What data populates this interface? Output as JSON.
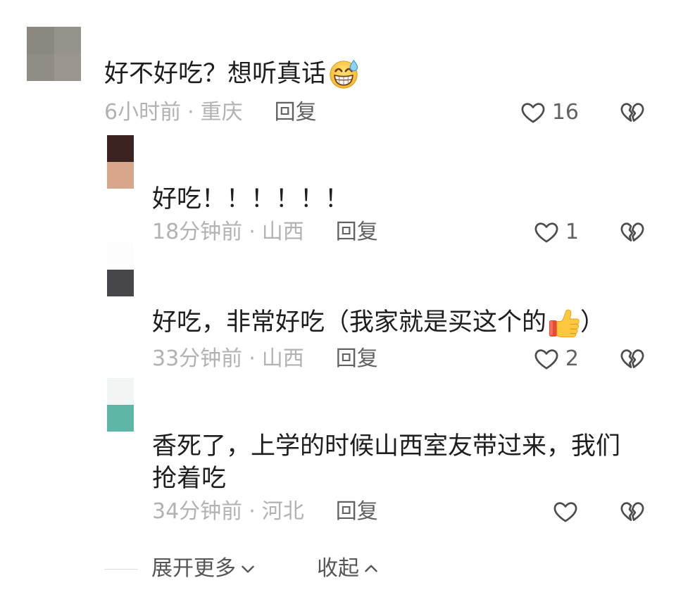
{
  "colors": {
    "text": "#1e1e1e",
    "meta": "#b2b2b2",
    "action": "#626262",
    "icon": "#4c4c4c",
    "divider": "#dddddd",
    "footer": "#555555"
  },
  "separator": "·",
  "icons": {
    "like": "heart-outline",
    "dislike": "broken-heart",
    "expand": "chevron-down",
    "collapse": "chevron-up"
  },
  "comment": {
    "avatar_colors": [
      "#8b8781",
      "#96928c",
      "#8f8b85",
      "#9a968f"
    ],
    "text": "好不好吃？想听真话",
    "emoji": "grinning-face-with-sweat",
    "time": "6小时前",
    "location": "重庆",
    "reply_label": "回复",
    "likes": 16
  },
  "replies": [
    {
      "avatar_colors": [
        "#3a2320",
        "#d8a68a"
      ],
      "text": "好吃！！！！！！",
      "time": "18分钟前",
      "location": "山西",
      "reply_label": "回复",
      "likes": 1
    },
    {
      "avatar_colors": [
        "#fdfdfd",
        "#47474b"
      ],
      "text": "好吃，非常好吃（我家就是买这个的",
      "emoji": "thumbs-up",
      "text_after": "）",
      "time": "33分钟前",
      "location": "山西",
      "reply_label": "回复",
      "likes": 2
    },
    {
      "avatar_colors": [
        "#f1f5f3",
        "#5db6a6"
      ],
      "text": "香死了，上学的时候山西室友带过来，我们抢着吃",
      "time": "34分钟前",
      "location": "河北",
      "reply_label": "回复"
    }
  ],
  "footer": {
    "expand_label": "展开更多",
    "collapse_label": "收起"
  }
}
